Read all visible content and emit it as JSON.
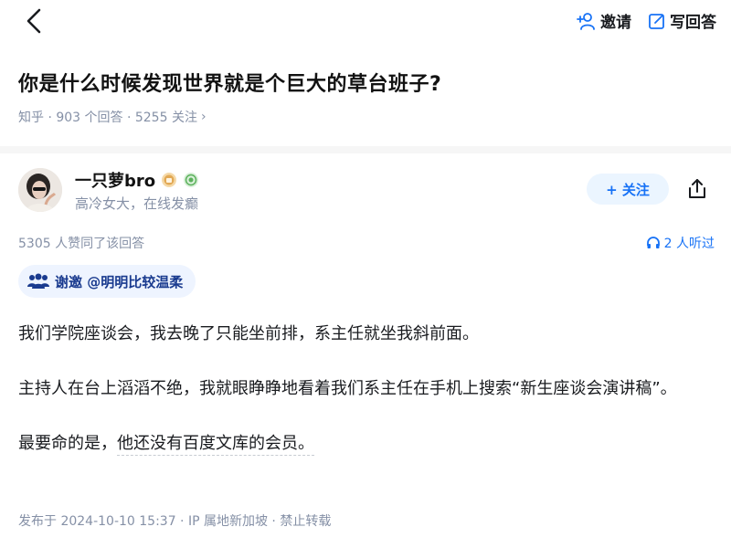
{
  "topbar": {
    "invite_label": "邀请",
    "write_answer_label": "写回答"
  },
  "question": {
    "title": "你是什么时候发现世界就是个巨大的草台班子?",
    "meta": "知乎 · 903 个回答 · 5255 关注",
    "meta_chevron": "›"
  },
  "author": {
    "name": "一只萝bro",
    "bio": "高冷女大，在线发癫",
    "follow_label": "+ 关注"
  },
  "stats": {
    "votes_text": "5305 人赞同了该回答",
    "listen_text": "2 人听过"
  },
  "invite": {
    "text": "谢邀 @明明比较温柔"
  },
  "answer": {
    "p1": "我们学院座谈会，我去晚了只能坐前排，系主任就坐我斜前面。",
    "p2": "主持人在台上滔滔不绝，我就眼睁睁地看着我们系主任在手机上搜索“新生座谈会演讲稿”。",
    "p3_a": "最要命的是，",
    "p3_b": "他还没有百度文库的会员。"
  },
  "publish": {
    "meta": "发布于 2024-10-10 15:37 · IP 属地新加坡 · 禁止转载"
  },
  "colors": {
    "accent": "#1772f6",
    "muted": "#8590a6",
    "follow_bg": "#ebf5ff",
    "invite_bg": "#eef4ff"
  },
  "icons": [
    "back-arrow-icon",
    "invite-icon",
    "write-answer-icon",
    "share-icon",
    "headphones-icon",
    "invite-group-icon",
    "level-badge-icon",
    "creator-badge-icon"
  ]
}
